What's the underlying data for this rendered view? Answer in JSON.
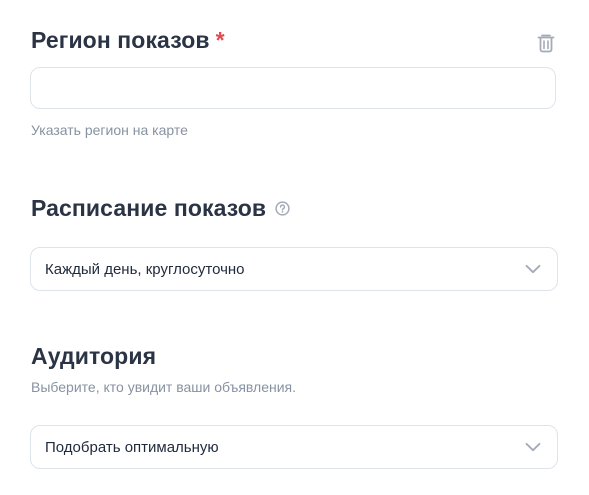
{
  "region": {
    "title": "Регион показов",
    "required_mark": "*",
    "input_value": "",
    "input_placeholder": "",
    "map_link": "Указать регион на карте",
    "delete_icon": "trash-icon"
  },
  "schedule": {
    "title": "Расписание показов",
    "help_icon": "question-circle-icon",
    "selected": "Каждый день, круглосуточно"
  },
  "audience": {
    "title": "Аудитория",
    "description": "Выберите, кто увидит ваши объявления.",
    "selected": "Подобрать оптимальную"
  },
  "colors": {
    "title": "#2b3445",
    "required": "#e5484d",
    "hint": "#8792a2",
    "border": "#dfe3ea",
    "icon": "#a3abb8"
  }
}
